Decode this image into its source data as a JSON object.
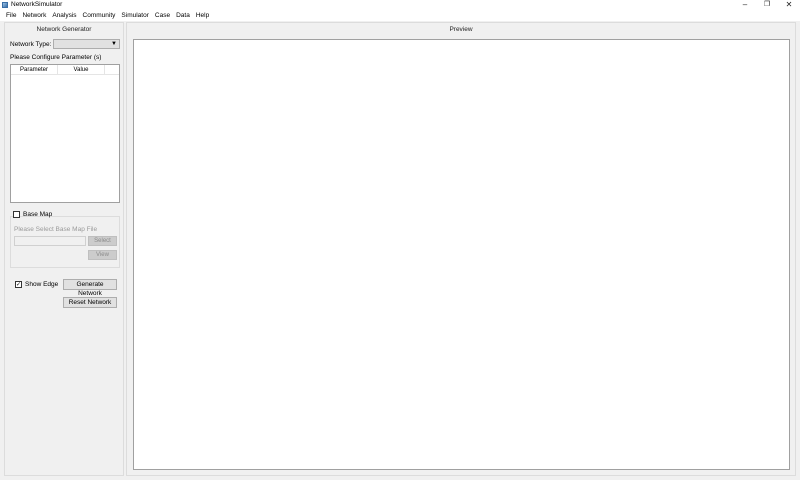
{
  "window": {
    "title": "NetworkSimulator",
    "controls": {
      "minimize": "–",
      "restore": "❐",
      "close": "✕"
    }
  },
  "menu": [
    "File",
    "Network",
    "Analysis",
    "Community",
    "Simulator",
    "Case",
    "Data",
    "Help"
  ],
  "generator": {
    "title": "Network Generator",
    "network_type_label": "Network Type:",
    "network_type_value": "",
    "configure_label": "Please Configure Parameter (s)",
    "table_headers": [
      "Parameter",
      "Value"
    ],
    "base_map": {
      "checkbox_label": "Base Map",
      "checked": false,
      "hint": "Please Select Base Map File",
      "file_value": "",
      "select_label": "Select",
      "view_label": "View"
    },
    "show_edge": {
      "label": "Show Edge",
      "checked": true
    },
    "generate_label": "Generate Network",
    "reset_label": "Reset Network"
  },
  "preview": {
    "title": "Preview"
  }
}
